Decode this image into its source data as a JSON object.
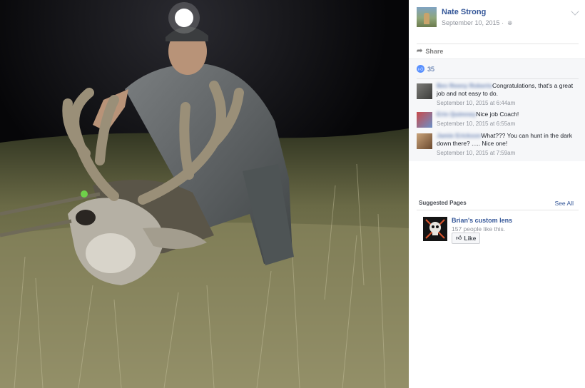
{
  "post": {
    "author": "Nate Strong",
    "date": "September 10, 2015",
    "date_separator": "·",
    "share_label": "Share",
    "likes_count": "35"
  },
  "comments": [
    {
      "author": "Bev Reeny Roberts",
      "text": "Congratulations, that's a great job and not easy to do.",
      "time": "September 10, 2015 at 6:44am"
    },
    {
      "author": "Erin Quimney",
      "text": "Nice job Coach!",
      "time": "September 10, 2015 at 6:55am"
    },
    {
      "author": "Jamie Erickson",
      "text": "What??? You can hunt in the dark down there? ..... Nice one!",
      "time": "September 10, 2015 at 7:59am"
    }
  ],
  "suggested": {
    "title": "Suggested Pages",
    "see_all": "See All",
    "page_name": "Brian's custom lens",
    "page_likes": "157 people like this.",
    "like_button": "Like"
  },
  "icons": {
    "share": "share-arrow-icon",
    "like": "thumbs-up-icon",
    "privacy": "globe-icon",
    "options": "chevron-down-icon"
  },
  "colors": {
    "link": "#365899",
    "muted": "#90949c",
    "comments_bg": "#f6f7f9",
    "like_blue": "#5890ff"
  }
}
